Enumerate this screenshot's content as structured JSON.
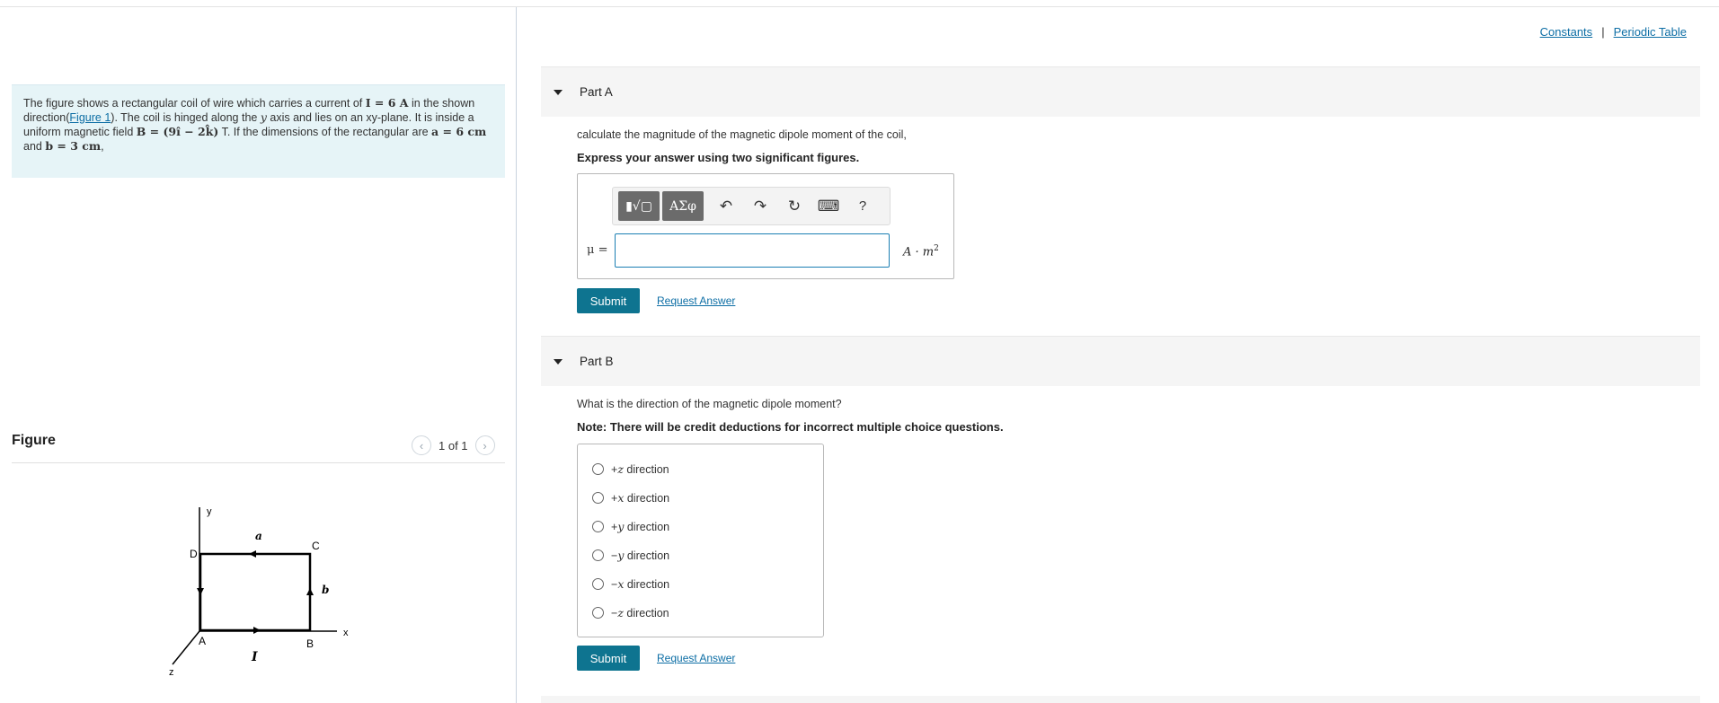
{
  "intro": {
    "line1_pre": "The figure shows a rectangular coil of wire which carries a current of ",
    "current_math": "I = 6 A",
    "line1_post": " in the shown direction(",
    "figure_link": "Figure 1",
    "line2": "). The coil is hinged along the ",
    "y_var": "y",
    "line2b": " axis and lies on an xy-plane. It is inside a uniform magnetic field ",
    "field_math": "B = (9î − 2k̂)",
    "line3": " T. If the dimensions of the rectangular are ",
    "dim_a": "a = 6 cm",
    "and": " and ",
    "dim_b": "b = 3 cm",
    "end": ","
  },
  "figure": {
    "title": "Figure",
    "count": "1 of 1",
    "labels": {
      "y": "y",
      "x": "x",
      "z": "z",
      "A": "A",
      "B": "B",
      "C": "C",
      "D": "D",
      "a": "a",
      "b": "b",
      "I": "I"
    }
  },
  "header_links": {
    "constants": "Constants",
    "separator": "|",
    "periodic_table": "Periodic Table"
  },
  "part_a": {
    "label": "Part A",
    "question": "calculate the magnitude of the magnetic dipole moment of the coil,",
    "instruction": "Express your answer using two significant figures.",
    "toolbar": {
      "templates": "▮√▢",
      "greek": "ΑΣφ",
      "undo": "↶",
      "redo": "↷",
      "reset": "↻",
      "keyboard": "⌨",
      "help": "?"
    },
    "answer_label": "μ =",
    "answer_value": "",
    "unit": "A · m",
    "unit_exp": "2",
    "submit": "Submit",
    "request": "Request Answer"
  },
  "part_b": {
    "label": "Part B",
    "question": "What is the direction of the magnetic dipole moment?",
    "instruction": "Note: There will be credit deductions for incorrect multiple choice questions.",
    "choices": [
      {
        "sign": "+",
        "axis": "z",
        "text": " direction"
      },
      {
        "sign": "+",
        "axis": "x",
        "text": " direction"
      },
      {
        "sign": "+",
        "axis": "y",
        "text": " direction"
      },
      {
        "sign": "−",
        "axis": "y",
        "text": " direction"
      },
      {
        "sign": "−",
        "axis": "x",
        "text": " direction"
      },
      {
        "sign": "−",
        "axis": "z",
        "text": " direction"
      }
    ],
    "submit": "Submit",
    "request": "Request Answer"
  },
  "colors": {
    "accent": "#0e7490",
    "link": "#0d6ea5",
    "intro_bg": "#e6f4f7",
    "part_header_bg": "#f5f5f5"
  }
}
